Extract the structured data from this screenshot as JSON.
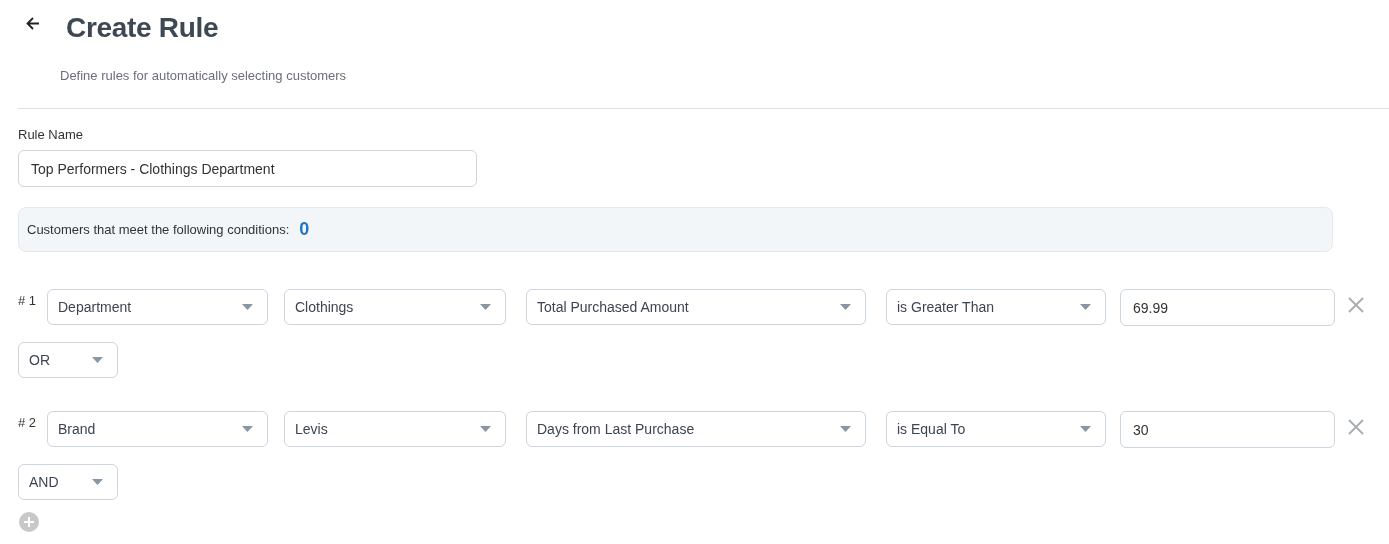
{
  "header": {
    "title": "Create Rule",
    "subtitle": "Define rules for automatically selecting customers"
  },
  "rule_name": {
    "label": "Rule Name",
    "value": "Top Performers - Clothings Department"
  },
  "summary": {
    "label": "Customers that meet the following conditions:",
    "count": "0"
  },
  "conditions": [
    {
      "number": "# 1",
      "dropdowns": [
        "Department",
        "Clothings",
        "Total Purchased Amount",
        "is Greater Than"
      ],
      "value": "69.99",
      "connector": "OR"
    },
    {
      "number": "# 2",
      "dropdowns": [
        "Brand",
        "Levis",
        "Days from Last Purchase",
        "is Equal To"
      ],
      "value": "30",
      "connector": "AND"
    }
  ]
}
